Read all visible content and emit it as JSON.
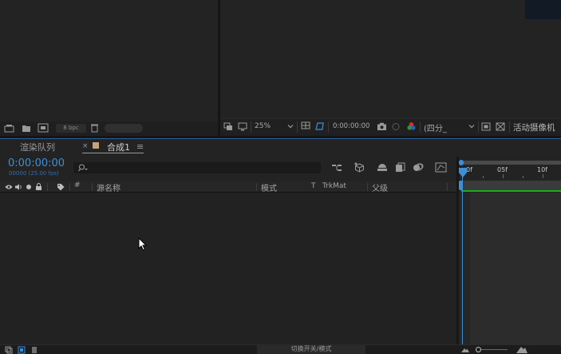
{
  "project_panel": {
    "bpc_label": "8 bpc"
  },
  "viewer_toolbar": {
    "zoom_value": "25%",
    "timecode": "0:00:00:00",
    "view_layout": "(四分_",
    "camera": "活动摄像机"
  },
  "timeline": {
    "tabs": [
      {
        "label": "渲染队列"
      },
      {
        "label": "合成1",
        "close": "×",
        "menu": "≡"
      }
    ],
    "current_time": "0:00:00:00",
    "frame_info": "00000 (25.00 fps)",
    "search": {
      "placeholder": "",
      "icon": "search-icon"
    },
    "columns": {
      "number": "#",
      "source_name": "源名称",
      "mode": "模式",
      "t": "T",
      "trkmat": "TrkMat",
      "parent": "父级"
    },
    "ruler": {
      "labels": [
        "0f",
        "05f",
        "10f"
      ]
    },
    "toggle_switches_label": "切换开关/模式"
  },
  "colors": {
    "accent_blue": "#3d8fd8",
    "duration_green": "#18b018",
    "comp_swatch": "#c8a27a",
    "panel_bg": "#232323"
  }
}
